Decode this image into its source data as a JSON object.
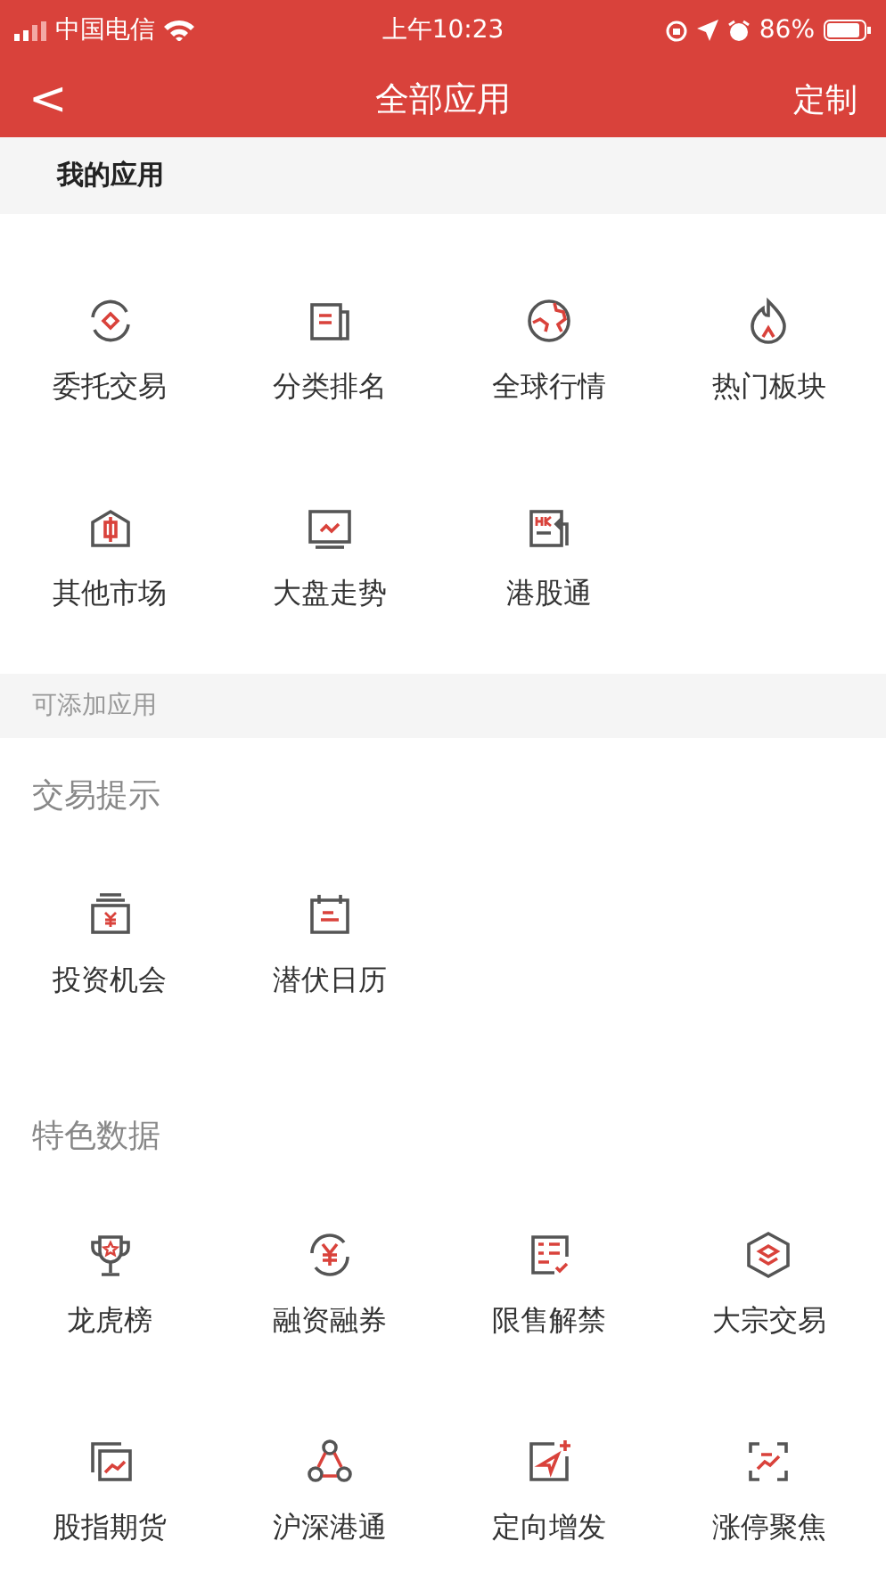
{
  "status_bar": {
    "carrier": "中国电信",
    "time": "上午10:23",
    "battery": "86%"
  },
  "nav": {
    "back": "<",
    "title": "全部应用",
    "action": "定制"
  },
  "my_apps": {
    "title": "我的应用",
    "items": [
      {
        "label": "委托交易"
      },
      {
        "label": "分类排名"
      },
      {
        "label": "全球行情"
      },
      {
        "label": "热门板块"
      },
      {
        "label": "其他市场"
      },
      {
        "label": "大盘走势"
      },
      {
        "label": "港股通"
      }
    ]
  },
  "addable": {
    "title": "可添加应用",
    "groups": [
      {
        "title": "交易提示",
        "items": [
          {
            "label": "投资机会"
          },
          {
            "label": "潜伏日历"
          }
        ]
      },
      {
        "title": "特色数据",
        "items": [
          {
            "label": "龙虎榜"
          },
          {
            "label": "融资融券"
          },
          {
            "label": "限售解禁"
          },
          {
            "label": "大宗交易"
          },
          {
            "label": "股指期货"
          },
          {
            "label": "沪深港通"
          },
          {
            "label": "定向增发"
          },
          {
            "label": "涨停聚焦"
          }
        ]
      }
    ]
  }
}
